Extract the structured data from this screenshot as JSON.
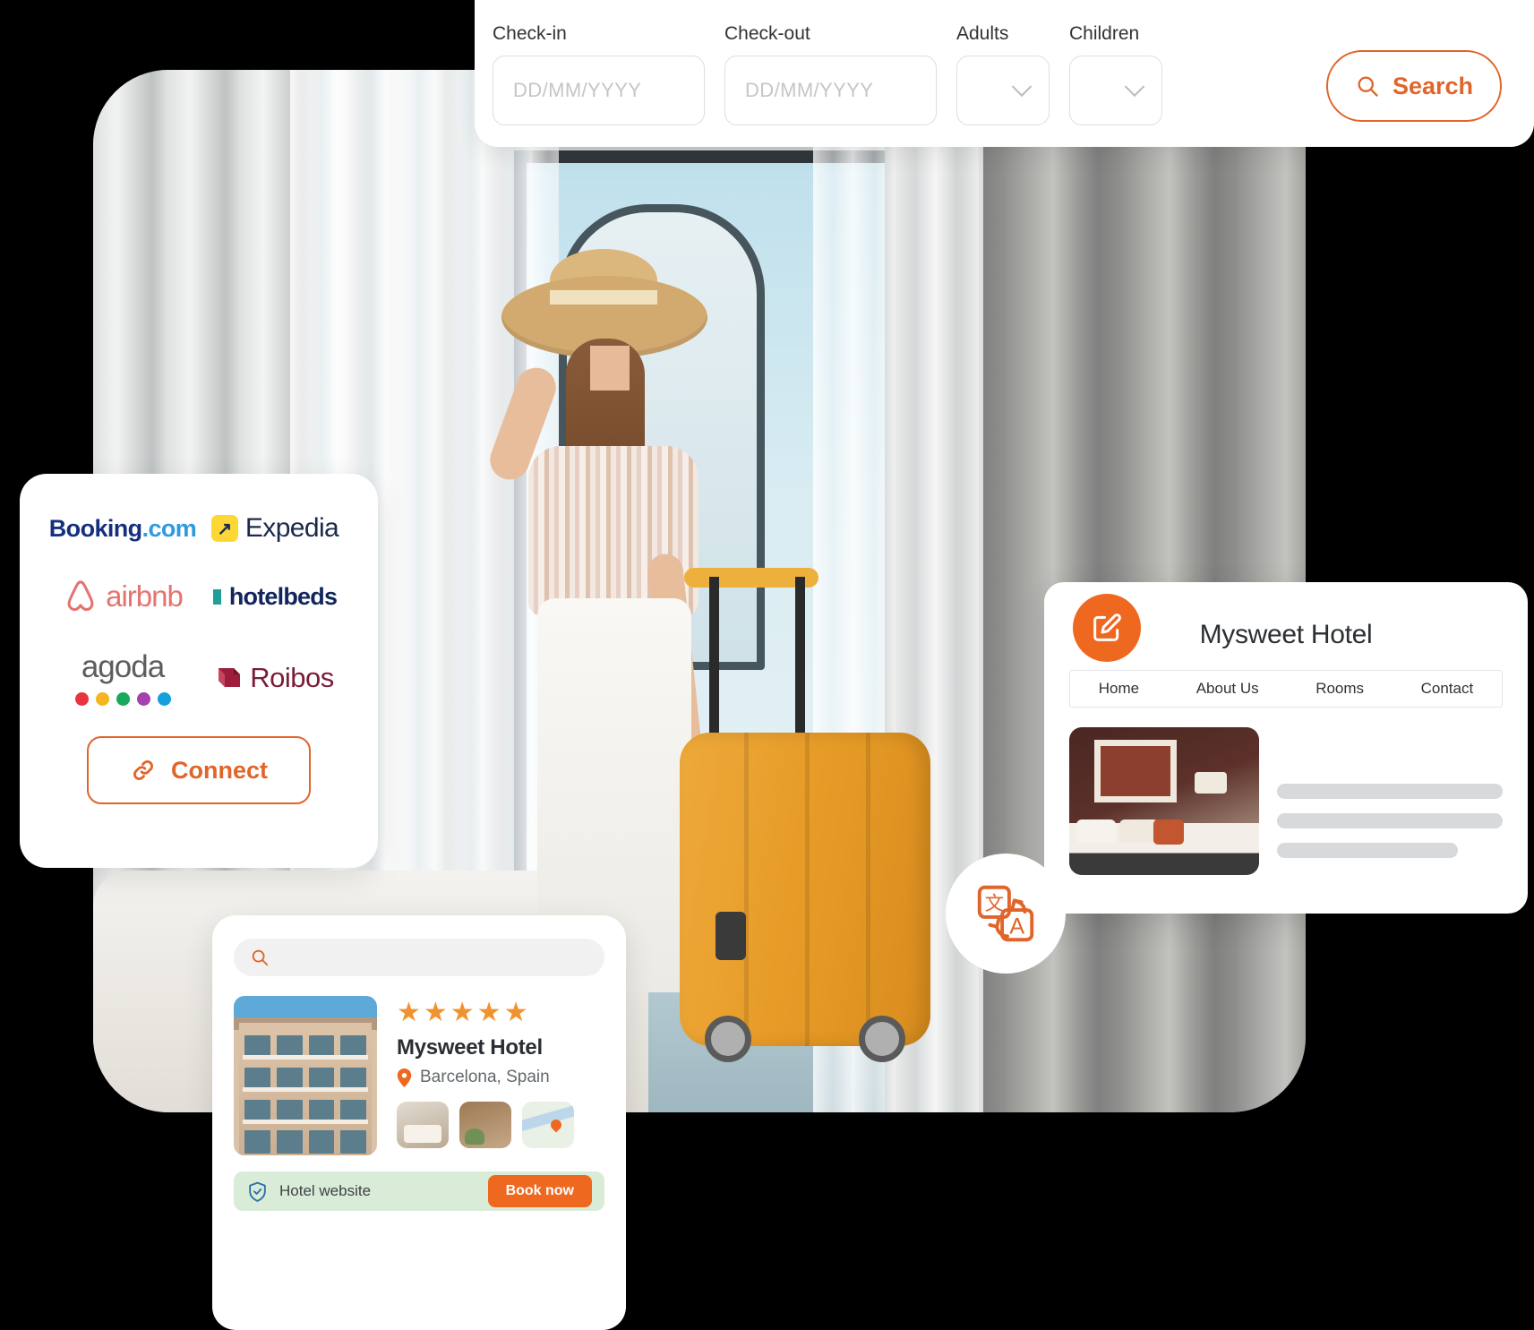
{
  "search_bar": {
    "fields": [
      {
        "label": "Check-in",
        "placeholder": "DD/MM/YYYY",
        "value": "",
        "name": "checkin"
      },
      {
        "label": "Check-out",
        "placeholder": "DD/MM/YYYY",
        "value": "",
        "name": "checkout"
      }
    ],
    "selects": [
      {
        "label": "Adults",
        "value": "",
        "name": "adults"
      },
      {
        "label": "Children",
        "value": "",
        "name": "children"
      }
    ],
    "search_button": "Search",
    "search_icon": "magnifier-icon",
    "accent_color": "#e0652a"
  },
  "ota_panel": {
    "logos": [
      {
        "name": "Booking.com",
        "part1": "Booking",
        "part2": ".com",
        "color1": "#16307f",
        "color2": "#2e9ae0"
      },
      {
        "name": "Expedia",
        "text": "Expedia",
        "icon": "arrow-up-right-icon",
        "badge_color": "#fdd835",
        "color": "#1b2a4a"
      },
      {
        "name": "airbnb",
        "text": "airbnb",
        "icon": "airbnb-belo-icon",
        "color": "#e5736f"
      },
      {
        "name": "hotelbeds",
        "text": "hotelbeds",
        "color": "#12255c",
        "accent": "#1f9f95"
      },
      {
        "name": "agoda",
        "text": "agoda",
        "color": "#5d5d5d",
        "dots": [
          "#e8343c",
          "#f6b41e",
          "#17a95a",
          "#a63fb0",
          "#15a0dd"
        ]
      },
      {
        "name": "Roibos",
        "text": "Roibos",
        "color": "#7a1d39",
        "mark_color": "#9e1d3c"
      }
    ],
    "connect_button": {
      "label": "Connect",
      "icon": "link-chain-icon",
      "color": "#e0652a"
    }
  },
  "website_card": {
    "title": "Mysweet Hotel",
    "nav": [
      "Home",
      "About Us",
      "Rooms",
      "Contact"
    ],
    "room_image_alt": "hotel-room-photo",
    "edit_badge": {
      "icon": "edit-pencil-icon",
      "color": "#ef6820"
    },
    "translate_badge": {
      "icon": "translate-icon",
      "color": "#e0652a",
      "glyphs": [
        "文",
        "A"
      ]
    }
  },
  "result_card": {
    "search_placeholder": "",
    "search_value": "",
    "search_icon": "magnifier-icon",
    "rating_stars": "★★★★★",
    "rating_value": 5,
    "hotel_name": "Mysweet Hotel",
    "location": "Barcelona, Spain",
    "location_icon": "map-pin-icon",
    "main_photo_alt": "hotel-building-barcelona",
    "thumbnails": [
      "room-thumbnail",
      "courtyard-thumbnail",
      "map-thumbnail"
    ],
    "booking_bar": {
      "shield_icon": "shield-check-icon",
      "label": "Hotel website",
      "button": "Book now",
      "bar_color": "#d9ecd8",
      "button_color": "#ef6820"
    }
  },
  "hero": {
    "alt": "woman-with-suitcase-in-hotel-room"
  }
}
